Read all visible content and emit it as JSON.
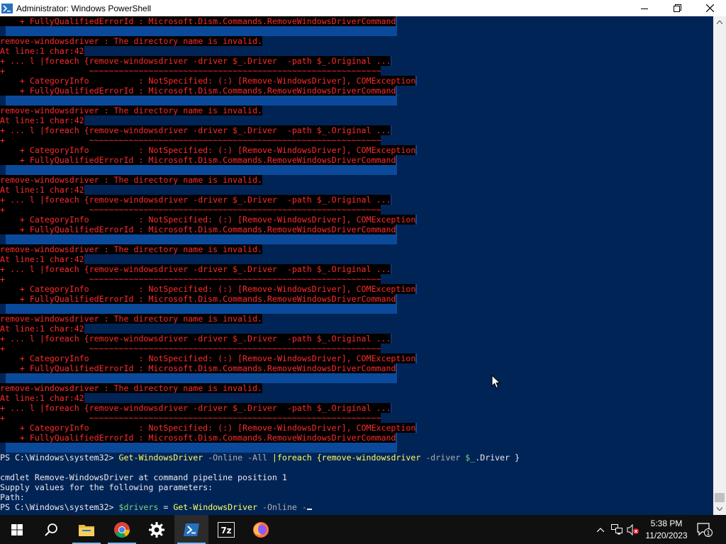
{
  "window": {
    "title": "Administrator: Windows PowerShell",
    "minimize_icon": "minimize-icon",
    "maximize_icon": "maximize-icon",
    "close_icon": "close-icon"
  },
  "console": {
    "top_partial_line": "    + FullyQualifiedErrorId : Microsoft.Dism.Commands.RemoveWindowsDriverCommand",
    "error_block": {
      "l1": "remove-windowsdriver : The directory name is invalid.",
      "l2": "At line:1 char:42",
      "l3": "+ ... l |foreach {remove-windowsdriver -driver $_.Driver  -path $_.Original ...",
      "l4": "+                 ~~~~~~~~~~~~~~~~~~~~~~~~~~~~~~~~~~~~~~~~~~~~~~~~~~~~~~~~~~~",
      "l5": "    + CategoryInfo          : NotSpecified: (:) [Remove-WindowsDriver], COMException",
      "l6": "    + FullyQualifiedErrorId : Microsoft.Dism.Commands.RemoveWindowsDriverCommand"
    },
    "prompt": "PS C:\\Windows\\system32> ",
    "cmd1": {
      "cmdlet": "Get-WindowsDriver",
      "p1": " -Online",
      "p2": " -All",
      "pipe": " |foreach {remove-windowsdriver",
      "p3": " -driver",
      "var": " $_",
      "rest": ".Driver }"
    },
    "out1": "cmdlet Remove-WindowsDriver at command pipeline position 1",
    "out2": "Supply values for the following parameters:",
    "out3": "Path:",
    "cmd2": {
      "var": "$drivers",
      "eq": " = ",
      "cmdlet": "Get-WindowsDriver",
      "p1": " -Online",
      "p2": " -"
    }
  },
  "taskbar": {
    "items": [
      "windows-start-icon",
      "search-icon",
      "file-explorer-icon",
      "chrome-icon",
      "settings-gear-icon",
      "powershell-icon",
      "7zip-icon",
      "firefox-icon"
    ],
    "seven_zip_label": "7z",
    "active_item": "powershell-icon",
    "clock_time": "5:38 PM",
    "clock_date": "11/20/2023",
    "notification_count": "1",
    "accent_color": "#76b9ed"
  },
  "colors": {
    "console_bg": "#012456",
    "error_text": "#ff2a2a",
    "command_text": "#ffff64",
    "selection": "#0b4a9a"
  }
}
